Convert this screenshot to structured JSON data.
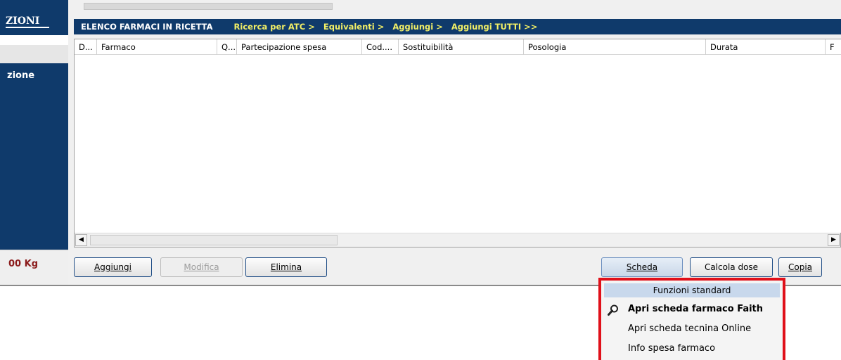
{
  "sidebar": {
    "title": "ZIONI",
    "panel_label": "zione",
    "weight": "00 Kg"
  },
  "toolbar": {
    "title": "ELENCO FARMACI IN RICETTA",
    "links": [
      "Ricerca per ATC >",
      "Equivalenti >",
      "Aggiungi >",
      "Aggiungi TUTTI >>"
    ]
  },
  "grid": {
    "columns": [
      "D...",
      "Farmaco",
      "Q...",
      "Partecipazione spesa",
      "Cod....",
      "Sostituibilità",
      "Posologia",
      "Durata",
      "F"
    ]
  },
  "buttons": {
    "aggiungi": "Aggiungi",
    "modifica": "Modifica",
    "elimina": "Elimina",
    "scheda": "Scheda",
    "calcola_dose": "Calcola dose",
    "copia": "Copia"
  },
  "popup": {
    "header": "Funzioni standard",
    "items": [
      {
        "label": "Apri scheda farmaco Faith",
        "icon": "magnifier-icon"
      },
      {
        "label": "Apri scheda tecnina Online"
      },
      {
        "label": "Info spesa farmaco"
      }
    ]
  },
  "colors": {
    "navy": "#0f3a6b",
    "link_yellow": "#f3f066",
    "highlight_red": "#e0101a",
    "weight_red": "#8b1b1b"
  }
}
